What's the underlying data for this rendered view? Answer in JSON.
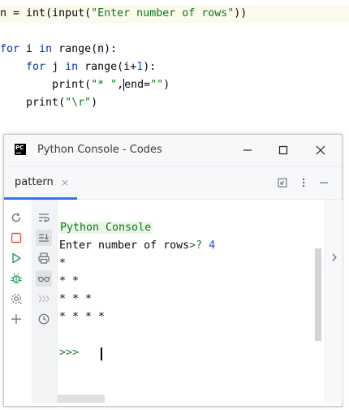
{
  "editor": {
    "line1": {
      "var": "n",
      "eq": " = ",
      "fn1": "int",
      "p1": "(",
      "fn2": "input",
      "p2": "(",
      "str": "\"Enter number of rows\"",
      "p3": "))"
    },
    "line3": {
      "kw1": "for",
      "var": " i ",
      "kw2": "in",
      "fn": " range",
      "p1": "(",
      "arg": "n",
      "p2": "):"
    },
    "line4": {
      "indent": "    ",
      "kw1": "for",
      "var": " j ",
      "kw2": "in",
      "fn": " range",
      "p1": "(i+",
      "num": "1",
      "p2": "):"
    },
    "line5": {
      "indent": "        ",
      "fn": "print",
      "p1": "(",
      "str1": "\"* \"",
      "sep": ",",
      "kwarg": "end=",
      "str2": "\"\"",
      "p2": ")"
    },
    "line6": {
      "indent": "    ",
      "fn": "print",
      "p1": "(",
      "str": "\"\\r\"",
      "p2": ")"
    }
  },
  "window": {
    "app_icon": "PC",
    "title": "Python Console - Codes",
    "minimize_icon": "minimize-icon",
    "maximize_icon": "maximize-icon",
    "close_icon": "close-icon"
  },
  "tabs": [
    {
      "label": "pattern",
      "close": "×",
      "active": true
    }
  ],
  "console": {
    "title": "Python Console",
    "prompt_text": "Enter number of rows",
    "prompt_hint": ">? ",
    "prompt_value": "4",
    "output": [
      "*",
      "* *",
      "* * *",
      "* * * *"
    ],
    "prompt_marker": ">>>"
  },
  "colors": {
    "accent": "#3574f0",
    "keyword": "#0033b3",
    "string": "#067d17",
    "number": "#1750eb",
    "stop": "#e55353",
    "run": "#1f9d55"
  }
}
